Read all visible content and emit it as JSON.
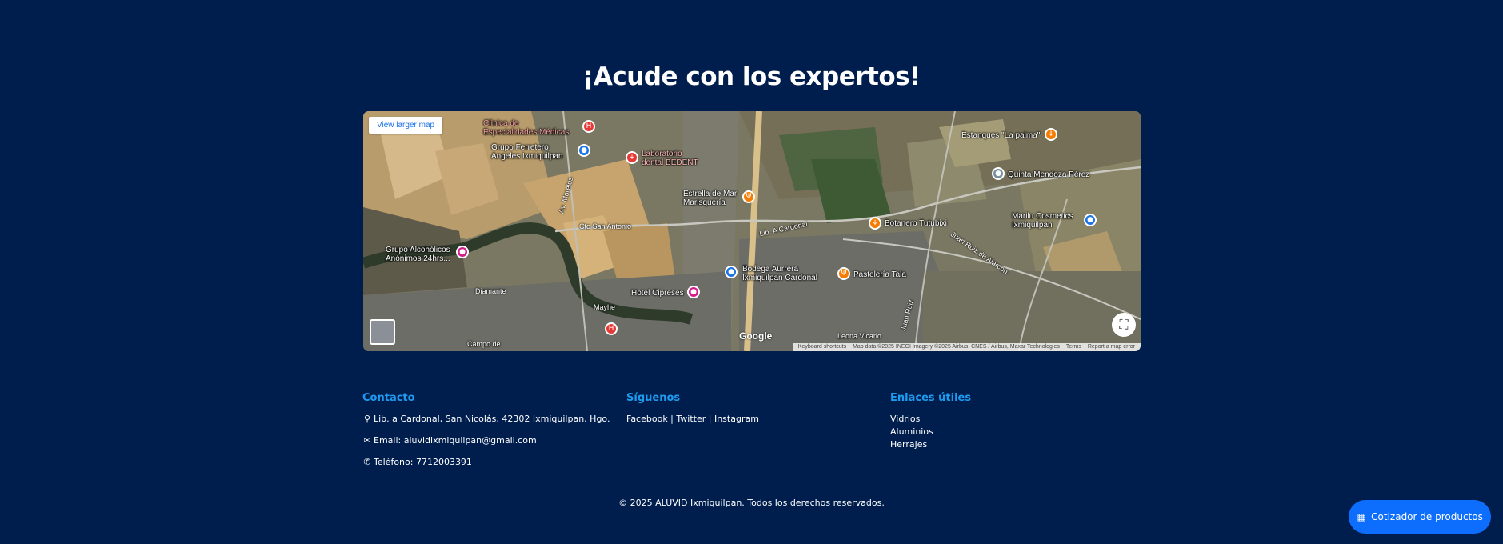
{
  "heading": "¡Acude con los expertos!",
  "map": {
    "view_larger": "View larger map",
    "places": [
      {
        "label": "Clínica de\nEspecialidades Médicas",
        "icon": "hospital-icon"
      },
      {
        "label": "Grupo Ferretero\nAngeles Ixmiquilpan",
        "icon": "shopping-icon"
      },
      {
        "label": "Laboratorio\ndental BEDENT",
        "icon": "medical-icon"
      },
      {
        "label": "Estrella de Mar\nMarisquería",
        "icon": "restaurant-icon"
      },
      {
        "label": "Estanques \"La palma\"",
        "icon": "restaurant-icon"
      },
      {
        "label": "Quinta Mendoza Pérez",
        "icon": "place-icon"
      },
      {
        "label": "Marilu Cosmetics\nIxmiquilpan",
        "icon": "shopping-icon"
      },
      {
        "label": "Botanero Tutubixi",
        "icon": "restaurant-icon"
      },
      {
        "label": "Grupo Alcohólicos\nAnónimos 24hrs...",
        "icon": "lodging-icon"
      },
      {
        "label": "Bodega Aurrera\nIxmiquilpan Cardonal",
        "icon": "cart-icon"
      },
      {
        "label": "Pastelería Tala",
        "icon": "restaurant-icon"
      },
      {
        "label": "Hotel Cipreses",
        "icon": "hotel-icon"
      }
    ],
    "roads": [
      "Cto San Antonio",
      "Lib. A Cardonal",
      "Juan Ruiz de Alarcón",
      "Diamante",
      "Mayhe",
      "Leona Vicario",
      "Campo de",
      "Juan Ruiz",
      "Av. Morelos"
    ],
    "google": "Google",
    "attribution": {
      "shortcuts": "Keyboard shortcuts",
      "data": "Map data ©2025 INEGI Imagery ©2025 Airbus, CNES / Airbus, Maxar Technologies",
      "terms": "Terms",
      "report": "Report a map error"
    }
  },
  "footer": {
    "contact": {
      "title": "Contacto",
      "address": "Lib. a Cardonal, San Nicolás, 42302 Ixmiquilpan, Hgo.",
      "email": "Email: aluvidixmiquilpan@gmail.com",
      "phone": "Teléfono: 7712003391"
    },
    "follow": {
      "title": "Síguenos",
      "facebook": "Facebook",
      "twitter": "Twitter",
      "instagram": "Instagram",
      "separator": " | "
    },
    "links": {
      "title": "Enlaces útiles",
      "items": [
        "Vidrios",
        "Aluminios",
        "Herrajes"
      ]
    },
    "copyright": "© 2025 ALUVID Ixmiquilpan. Todos los derechos reservados."
  },
  "quote_button": "Cotizador de productos",
  "colors": {
    "background": "#001e4d",
    "accent": "#1d9bf0",
    "button": "#0d6efd"
  }
}
